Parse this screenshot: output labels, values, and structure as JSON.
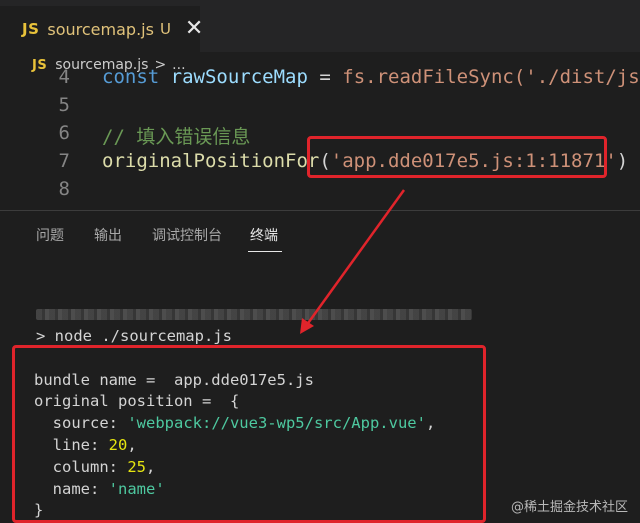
{
  "tab": {
    "badge": "JS",
    "filename": "sourcemap.js",
    "status": "U",
    "close_glyph": "✕"
  },
  "breadcrumb": {
    "badge": "JS",
    "file": "sourcemap.js",
    "separator": ">",
    "more": "..."
  },
  "editor": {
    "lines": [
      {
        "num": "4",
        "parts": [
          "const",
          " rawSourceMap ",
          "=",
          " fs.readFileSync('./dist/js/a"
        ]
      },
      {
        "num": "5",
        "text": ""
      },
      {
        "num": "6",
        "comment": "// 填入错误信息"
      },
      {
        "num": "7",
        "fn": "originalPositionFor",
        "open": "(",
        "arg": "'app.dde017e5.js:1:11871'",
        "close": ")"
      },
      {
        "num": "8",
        "text": ""
      }
    ]
  },
  "panel": {
    "tabs": [
      "问题",
      "输出",
      "调试控制台",
      "终端"
    ],
    "active_tab": "终端"
  },
  "terminal": {
    "command": "> node ./sourcemap.js",
    "bundle_label": "bundle name =  ",
    "bundle_value": "app.dde017e5.js",
    "original_label": "original position =  {",
    "source_key": "  source: ",
    "source_value": "'webpack://vue3-wp5/src/App.vue'",
    "line_key": "  line: ",
    "line_value": "20",
    "column_key": "  column: ",
    "column_value": "25",
    "name_key": "  name: ",
    "name_value": "'name'",
    "comma": ",",
    "close": "}"
  },
  "watermark": "@稀土掘金技术社区",
  "colors": {
    "highlight_red": "#e0242b",
    "js_badge": "#e8c23a",
    "string_green": "#4ec9a0",
    "number_yellow": "#e5e510"
  }
}
